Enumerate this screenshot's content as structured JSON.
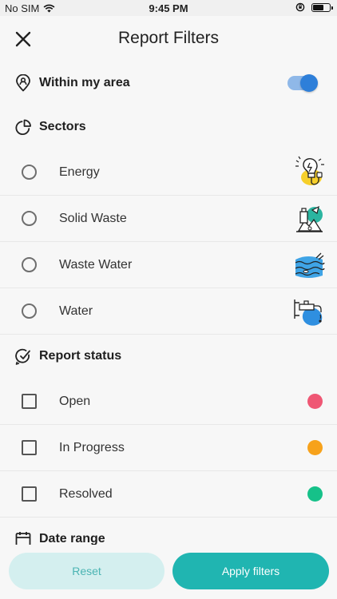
{
  "status_bar": {
    "carrier": "No SIM",
    "time": "9:45 PM"
  },
  "header": {
    "title": "Report Filters",
    "close_icon": "close-icon"
  },
  "area": {
    "label": "Within my area",
    "icon": "location-pin-icon",
    "enabled": true,
    "accent": "#2e7fd9"
  },
  "sectors": {
    "label": "Sectors",
    "icon": "pie-chart-icon",
    "items": [
      {
        "label": "Energy",
        "icon": "energy-illustration"
      },
      {
        "label": "Solid Waste",
        "icon": "solid-waste-illustration"
      },
      {
        "label": "Waste Water",
        "icon": "waste-water-illustration"
      },
      {
        "label": "Water",
        "icon": "water-tap-illustration"
      }
    ]
  },
  "report_status": {
    "label": "Report status",
    "icon": "status-check-icon",
    "items": [
      {
        "label": "Open",
        "color": "#ef5774"
      },
      {
        "label": "In Progress",
        "color": "#f7a21b"
      },
      {
        "label": "Resolved",
        "color": "#16c189"
      }
    ]
  },
  "date_range": {
    "label": "Date range",
    "icon": "calendar-icon"
  },
  "footer": {
    "reset_label": "Reset",
    "apply_label": "Apply filters"
  }
}
